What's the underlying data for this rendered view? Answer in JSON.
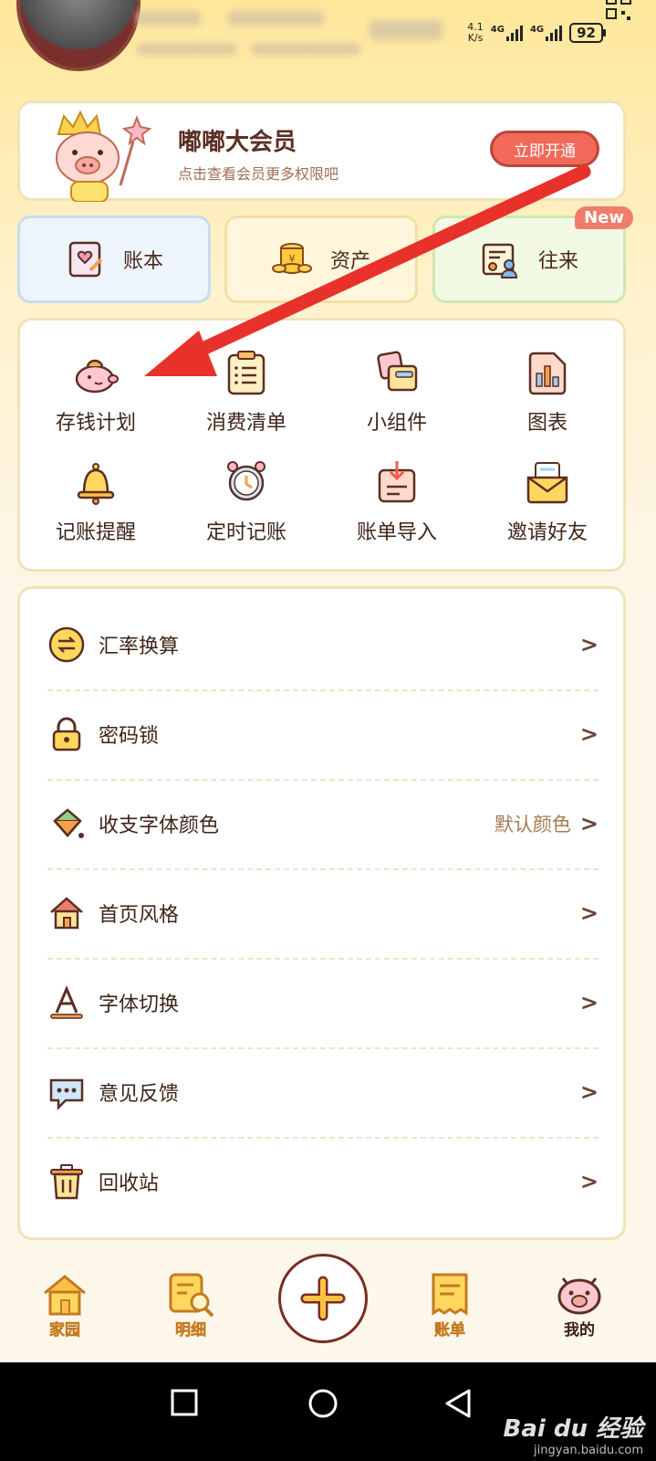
{
  "status_bar": {
    "speed_top": "4.1",
    "speed_bottom": "K/s",
    "net1": "4G",
    "net2": "4G",
    "battery": "92"
  },
  "vip": {
    "title": "嘟嘟大会员",
    "subtitle": "点击查看会员更多权限吧",
    "button": "立即开通"
  },
  "quick": [
    {
      "label": "账本",
      "icon": "ledger-icon"
    },
    {
      "label": "资产",
      "icon": "coins-icon"
    },
    {
      "label": "往来",
      "icon": "contact-card-icon"
    }
  ],
  "new_badge": "New",
  "tools": [
    {
      "label": "存钱计划",
      "icon": "piggy-bank-icon"
    },
    {
      "label": "消费清单",
      "icon": "clipboard-list-icon"
    },
    {
      "label": "小组件",
      "icon": "widget-icon"
    },
    {
      "label": "图表",
      "icon": "chart-icon"
    },
    {
      "label": "记账提醒",
      "icon": "bell-icon"
    },
    {
      "label": "定时记账",
      "icon": "alarm-clock-icon"
    },
    {
      "label": "账单导入",
      "icon": "import-icon"
    },
    {
      "label": "邀请好友",
      "icon": "invite-envelope-icon"
    }
  ],
  "settings": [
    {
      "label": "汇率换算",
      "value": "",
      "icon": "exchange-icon"
    },
    {
      "label": "密码锁",
      "value": "",
      "icon": "lock-icon"
    },
    {
      "label": "收支字体颜色",
      "value": "默认颜色",
      "icon": "paint-bucket-icon"
    },
    {
      "label": "首页风格",
      "value": "",
      "icon": "house-icon"
    },
    {
      "label": "字体切换",
      "value": "",
      "icon": "font-icon"
    },
    {
      "label": "意见反馈",
      "value": "",
      "icon": "feedback-icon"
    },
    {
      "label": "回收站",
      "value": "",
      "icon": "trash-icon"
    }
  ],
  "nav": [
    {
      "label": "家园",
      "icon": "home-icon"
    },
    {
      "label": "明细",
      "icon": "details-search-icon"
    },
    {
      "label": "账单",
      "icon": "bill-icon"
    },
    {
      "label": "我的",
      "icon": "pig-profile-icon"
    }
  ],
  "watermark": {
    "line1": "Bai du 经验",
    "line2": "jingyan.baidu.com"
  },
  "colors": {
    "accent": "#f2695a",
    "brand_yellow": "#ffe79a",
    "annotation_arrow": "#e8312a"
  }
}
